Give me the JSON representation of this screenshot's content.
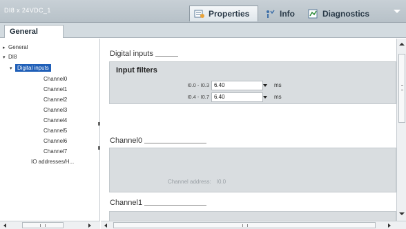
{
  "window": {
    "title": "DI8 x 24VDC_1",
    "tabs": [
      {
        "label": "Properties",
        "icon": "properties-icon",
        "active": true
      },
      {
        "label": "Info",
        "icon": "info-icon",
        "active": false
      },
      {
        "label": "Diagnostics",
        "icon": "diagnostics-icon",
        "active": false
      }
    ]
  },
  "subtabs": {
    "general": "General"
  },
  "tree": {
    "items": [
      {
        "label": "General",
        "arrow": "▸",
        "level": 0
      },
      {
        "label": "DI8",
        "arrow": "▾",
        "level": 0
      },
      {
        "label": "Digital inputs",
        "arrow": "▾",
        "level": 1,
        "selected": true
      },
      {
        "label": "Channel0",
        "level": 2
      },
      {
        "label": "Channel1",
        "level": 2
      },
      {
        "label": "Channel2",
        "level": 2
      },
      {
        "label": "Channel3",
        "level": 2
      },
      {
        "label": "Channel4",
        "level": 2
      },
      {
        "label": "Channel5",
        "level": 2
      },
      {
        "label": "Channel6",
        "level": 2
      },
      {
        "label": "Channel7",
        "level": 2
      },
      {
        "label": "IO addresses/H...",
        "level": 1
      }
    ]
  },
  "content": {
    "digital_inputs_header": "Digital inputs",
    "input_filters_label": "Input filters",
    "filters": [
      {
        "range": "I0.0 - I0.3",
        "value": "6.40",
        "unit": "ms"
      },
      {
        "range": "I0.4 - I0.7",
        "value": "6.40",
        "unit": "ms"
      }
    ],
    "channel0_header": "Channel0",
    "channel_address_label": "Channel address:",
    "channel_address_value": "I0.0",
    "channel1_header": "Channel1"
  },
  "colors": {
    "selection": "#1f5fb8",
    "panel_bg": "#d9dde0",
    "titlebar": "#b7c1c8"
  }
}
